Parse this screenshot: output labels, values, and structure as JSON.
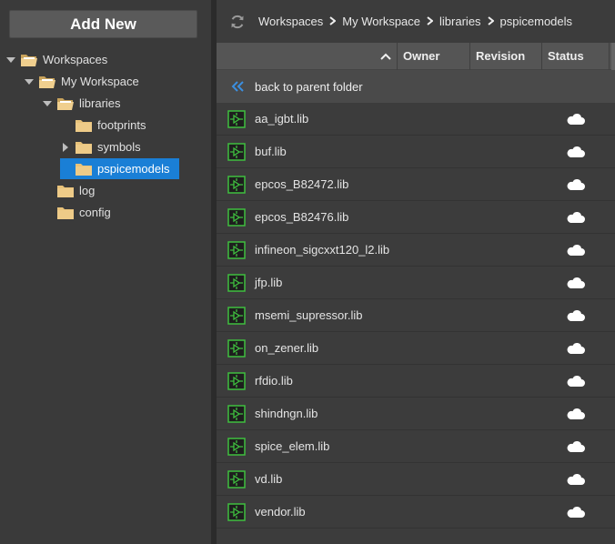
{
  "sidebar": {
    "add_new_label": "Add New",
    "tree": [
      {
        "label": "Workspaces",
        "arrow": "down"
      },
      {
        "label": "My Workspace",
        "arrow": "down"
      },
      {
        "label": "libraries",
        "arrow": "down"
      },
      {
        "label": "footprints",
        "arrow": "none"
      },
      {
        "label": "symbols",
        "arrow": "right"
      },
      {
        "label": "pspicemodels",
        "arrow": "none",
        "selected": true
      },
      {
        "label": "log",
        "arrow": "none"
      },
      {
        "label": "config",
        "arrow": "none"
      }
    ]
  },
  "breadcrumb": [
    "Workspaces",
    "My Workspace",
    "libraries",
    "pspicemodels"
  ],
  "table": {
    "columns": {
      "owner": "Owner",
      "revision": "Revision",
      "status": "Status"
    },
    "back_label": "back to parent folder",
    "files": [
      "aa_igbt.lib",
      "buf.lib",
      "epcos_B82472.lib",
      "epcos_B82476.lib",
      "infineon_sigcxxt120_l2.lib",
      "jfp.lib",
      "msemi_supressor.lib",
      "on_zener.lib",
      "rfdio.lib",
      "shindngn.lib",
      "spice_elem.lib",
      "vd.lib",
      "vendor.lib"
    ]
  },
  "colors": {
    "selected": "#1a7fd6",
    "folder": "#e8c27a",
    "lib_icon": "#3fbf3f",
    "cloud": "#ffffff"
  }
}
